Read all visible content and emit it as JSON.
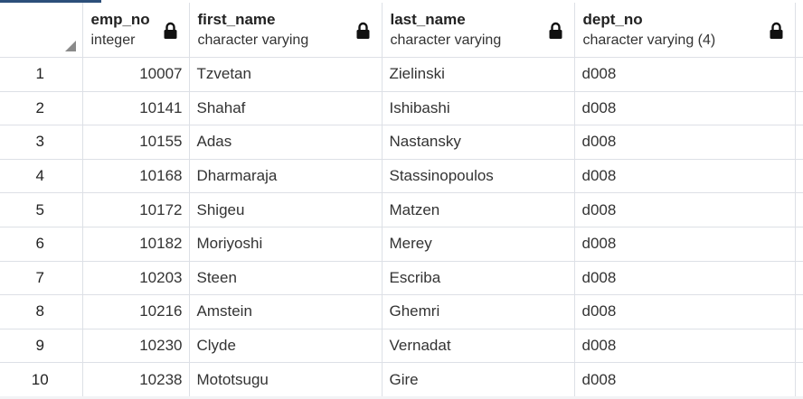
{
  "columns": [
    {
      "name": "emp_no",
      "type": "integer",
      "locked": true
    },
    {
      "name": "first_name",
      "type": "character varying",
      "locked": true
    },
    {
      "name": "last_name",
      "type": "character varying",
      "locked": true
    },
    {
      "name": "dept_no",
      "type": "character varying (4)",
      "locked": true
    }
  ],
  "rows": [
    {
      "n": "1",
      "emp_no": "10007",
      "first_name": "Tzvetan",
      "last_name": "Zielinski",
      "dept_no": "d008"
    },
    {
      "n": "2",
      "emp_no": "10141",
      "first_name": "Shahaf",
      "last_name": "Ishibashi",
      "dept_no": "d008"
    },
    {
      "n": "3",
      "emp_no": "10155",
      "first_name": "Adas",
      "last_name": "Nastansky",
      "dept_no": "d008"
    },
    {
      "n": "4",
      "emp_no": "10168",
      "first_name": "Dharmaraja",
      "last_name": "Stassinopoulos",
      "dept_no": "d008"
    },
    {
      "n": "5",
      "emp_no": "10172",
      "first_name": "Shigeu",
      "last_name": "Matzen",
      "dept_no": "d008"
    },
    {
      "n": "6",
      "emp_no": "10182",
      "first_name": "Moriyoshi",
      "last_name": "Merey",
      "dept_no": "d008"
    },
    {
      "n": "7",
      "emp_no": "10203",
      "first_name": "Steen",
      "last_name": "Escriba",
      "dept_no": "d008"
    },
    {
      "n": "8",
      "emp_no": "10216",
      "first_name": "Amstein",
      "last_name": "Ghemri",
      "dept_no": "d008"
    },
    {
      "n": "9",
      "emp_no": "10230",
      "first_name": "Clyde",
      "last_name": "Vernadat",
      "dept_no": "d008"
    },
    {
      "n": "10",
      "emp_no": "10238",
      "first_name": "Mototsugu",
      "last_name": "Gire",
      "dept_no": "d008"
    }
  ],
  "icons": {
    "lock": "lock-icon",
    "corner": "select-all-corner"
  },
  "colors": {
    "grid_line": "#dde0e6",
    "accent": "#2c4f7a",
    "text": "#333333"
  }
}
